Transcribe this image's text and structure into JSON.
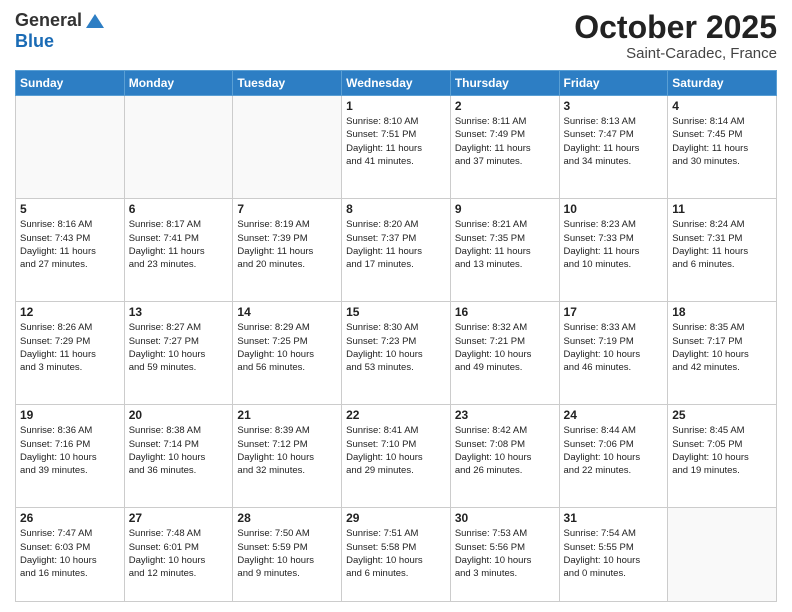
{
  "logo": {
    "general": "General",
    "blue": "Blue"
  },
  "title": "October 2025",
  "location": "Saint-Caradec, France",
  "weekdays": [
    "Sunday",
    "Monday",
    "Tuesday",
    "Wednesday",
    "Thursday",
    "Friday",
    "Saturday"
  ],
  "weeks": [
    [
      {
        "day": "",
        "text": ""
      },
      {
        "day": "",
        "text": ""
      },
      {
        "day": "",
        "text": ""
      },
      {
        "day": "1",
        "text": "Sunrise: 8:10 AM\nSunset: 7:51 PM\nDaylight: 11 hours\nand 41 minutes."
      },
      {
        "day": "2",
        "text": "Sunrise: 8:11 AM\nSunset: 7:49 PM\nDaylight: 11 hours\nand 37 minutes."
      },
      {
        "day": "3",
        "text": "Sunrise: 8:13 AM\nSunset: 7:47 PM\nDaylight: 11 hours\nand 34 minutes."
      },
      {
        "day": "4",
        "text": "Sunrise: 8:14 AM\nSunset: 7:45 PM\nDaylight: 11 hours\nand 30 minutes."
      }
    ],
    [
      {
        "day": "5",
        "text": "Sunrise: 8:16 AM\nSunset: 7:43 PM\nDaylight: 11 hours\nand 27 minutes."
      },
      {
        "day": "6",
        "text": "Sunrise: 8:17 AM\nSunset: 7:41 PM\nDaylight: 11 hours\nand 23 minutes."
      },
      {
        "day": "7",
        "text": "Sunrise: 8:19 AM\nSunset: 7:39 PM\nDaylight: 11 hours\nand 20 minutes."
      },
      {
        "day": "8",
        "text": "Sunrise: 8:20 AM\nSunset: 7:37 PM\nDaylight: 11 hours\nand 17 minutes."
      },
      {
        "day": "9",
        "text": "Sunrise: 8:21 AM\nSunset: 7:35 PM\nDaylight: 11 hours\nand 13 minutes."
      },
      {
        "day": "10",
        "text": "Sunrise: 8:23 AM\nSunset: 7:33 PM\nDaylight: 11 hours\nand 10 minutes."
      },
      {
        "day": "11",
        "text": "Sunrise: 8:24 AM\nSunset: 7:31 PM\nDaylight: 11 hours\nand 6 minutes."
      }
    ],
    [
      {
        "day": "12",
        "text": "Sunrise: 8:26 AM\nSunset: 7:29 PM\nDaylight: 11 hours\nand 3 minutes."
      },
      {
        "day": "13",
        "text": "Sunrise: 8:27 AM\nSunset: 7:27 PM\nDaylight: 10 hours\nand 59 minutes."
      },
      {
        "day": "14",
        "text": "Sunrise: 8:29 AM\nSunset: 7:25 PM\nDaylight: 10 hours\nand 56 minutes."
      },
      {
        "day": "15",
        "text": "Sunrise: 8:30 AM\nSunset: 7:23 PM\nDaylight: 10 hours\nand 53 minutes."
      },
      {
        "day": "16",
        "text": "Sunrise: 8:32 AM\nSunset: 7:21 PM\nDaylight: 10 hours\nand 49 minutes."
      },
      {
        "day": "17",
        "text": "Sunrise: 8:33 AM\nSunset: 7:19 PM\nDaylight: 10 hours\nand 46 minutes."
      },
      {
        "day": "18",
        "text": "Sunrise: 8:35 AM\nSunset: 7:17 PM\nDaylight: 10 hours\nand 42 minutes."
      }
    ],
    [
      {
        "day": "19",
        "text": "Sunrise: 8:36 AM\nSunset: 7:16 PM\nDaylight: 10 hours\nand 39 minutes."
      },
      {
        "day": "20",
        "text": "Sunrise: 8:38 AM\nSunset: 7:14 PM\nDaylight: 10 hours\nand 36 minutes."
      },
      {
        "day": "21",
        "text": "Sunrise: 8:39 AM\nSunset: 7:12 PM\nDaylight: 10 hours\nand 32 minutes."
      },
      {
        "day": "22",
        "text": "Sunrise: 8:41 AM\nSunset: 7:10 PM\nDaylight: 10 hours\nand 29 minutes."
      },
      {
        "day": "23",
        "text": "Sunrise: 8:42 AM\nSunset: 7:08 PM\nDaylight: 10 hours\nand 26 minutes."
      },
      {
        "day": "24",
        "text": "Sunrise: 8:44 AM\nSunset: 7:06 PM\nDaylight: 10 hours\nand 22 minutes."
      },
      {
        "day": "25",
        "text": "Sunrise: 8:45 AM\nSunset: 7:05 PM\nDaylight: 10 hours\nand 19 minutes."
      }
    ],
    [
      {
        "day": "26",
        "text": "Sunrise: 7:47 AM\nSunset: 6:03 PM\nDaylight: 10 hours\nand 16 minutes."
      },
      {
        "day": "27",
        "text": "Sunrise: 7:48 AM\nSunset: 6:01 PM\nDaylight: 10 hours\nand 12 minutes."
      },
      {
        "day": "28",
        "text": "Sunrise: 7:50 AM\nSunset: 5:59 PM\nDaylight: 10 hours\nand 9 minutes."
      },
      {
        "day": "29",
        "text": "Sunrise: 7:51 AM\nSunset: 5:58 PM\nDaylight: 10 hours\nand 6 minutes."
      },
      {
        "day": "30",
        "text": "Sunrise: 7:53 AM\nSunset: 5:56 PM\nDaylight: 10 hours\nand 3 minutes."
      },
      {
        "day": "31",
        "text": "Sunrise: 7:54 AM\nSunset: 5:55 PM\nDaylight: 10 hours\nand 0 minutes."
      },
      {
        "day": "",
        "text": ""
      }
    ]
  ]
}
